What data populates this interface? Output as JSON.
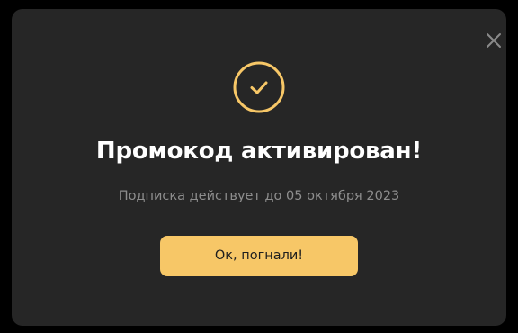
{
  "modal": {
    "icon": "check-circle-icon",
    "close_icon": "close-icon",
    "title": "Промокод активирован!",
    "subtitle": "Подписка действует до 05 октября 2023",
    "ok_button_label": "Ок, погнали!"
  },
  "colors": {
    "background": "#000000",
    "modal_background": "#262626",
    "accent": "#f7c767",
    "title_text": "#ffffff",
    "subtitle_text": "#8e8e8e",
    "button_text": "#1e1e1e"
  }
}
